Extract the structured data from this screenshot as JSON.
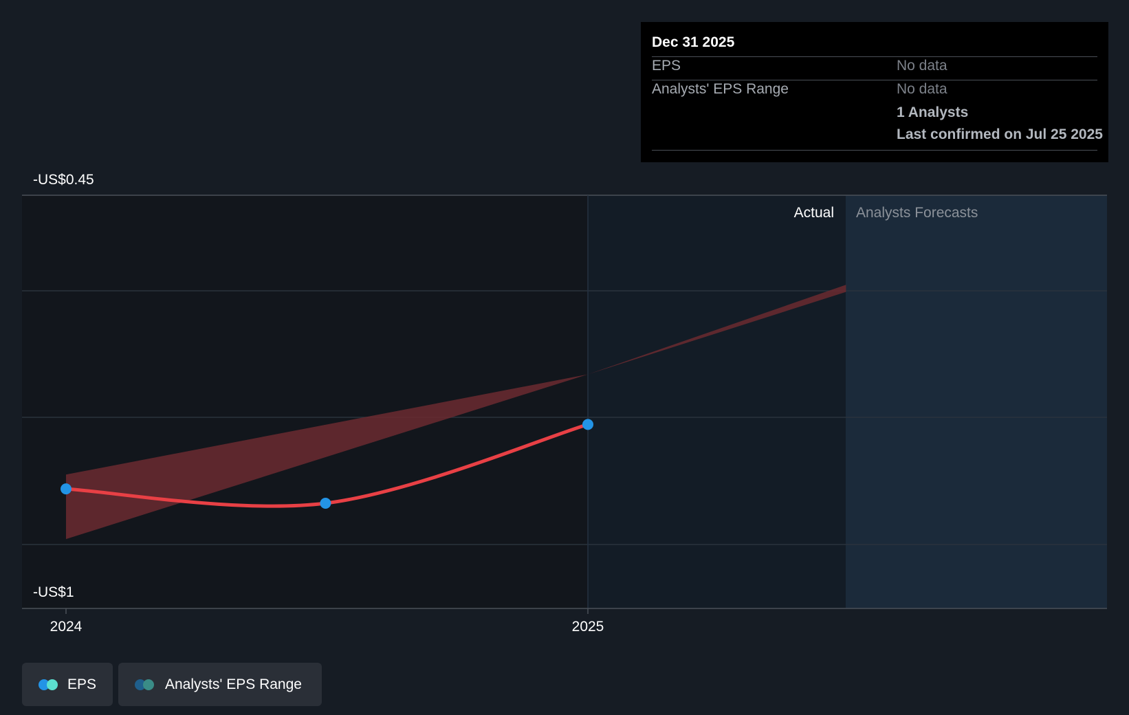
{
  "tooltip": {
    "date": "Dec 31 2025",
    "rows": [
      {
        "label": "EPS",
        "value": "No data"
      },
      {
        "label": "Analysts' EPS Range",
        "value": "No data"
      }
    ],
    "analysts": "1 Analysts",
    "confirmed": "Last confirmed on Jul 25 2025"
  },
  "legend": [
    {
      "label": "EPS",
      "colors": [
        "#2394e6",
        "#5ce0d0"
      ]
    },
    {
      "label": "Analysts' EPS Range",
      "colors": [
        "#1f5f8c",
        "#3a8c87"
      ]
    }
  ],
  "colors": {
    "background": "#161c24",
    "actual_region": "#12161c",
    "forecast_region": "#1b2a3a",
    "eps_line": "#e84045",
    "eps_point": "#2394e6",
    "range_fill": "#6b2a30"
  },
  "chart_data": {
    "type": "line",
    "x_ticks": [
      "2024",
      "2025"
    ],
    "y_axis_labels": {
      "top": "-US$0.45",
      "bottom": "-US$1"
    },
    "ylim": [
      -1,
      -0.45
    ],
    "region_labels": {
      "actual": "Actual",
      "forecast": "Analysts Forecasts"
    },
    "series": [
      {
        "name": "EPS",
        "points": [
          {
            "x": "2023-12-31",
            "y": -0.86
          },
          {
            "x": "2024-06-30",
            "y": -0.88
          },
          {
            "x": "2024-12-31",
            "y": -0.77
          }
        ]
      }
    ],
    "analysts_eps_range": [
      {
        "x": "2023-12-31",
        "low": -0.93,
        "high": -0.84
      },
      {
        "x": "2024-12-31",
        "low": -0.7,
        "high": -0.7
      },
      {
        "x": "2025-06-30",
        "low": -0.585,
        "high": -0.575
      }
    ],
    "grid": true
  }
}
